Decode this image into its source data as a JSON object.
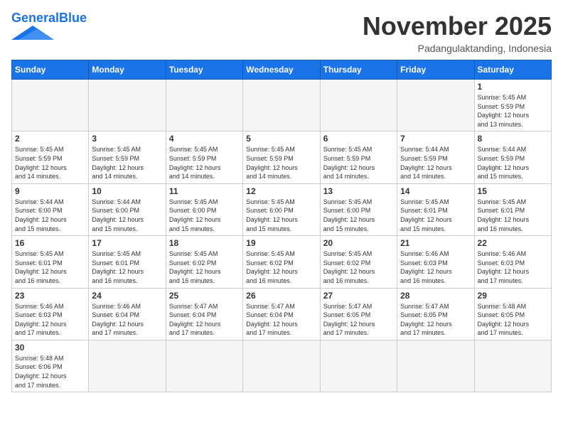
{
  "header": {
    "logo_general": "General",
    "logo_blue": "Blue",
    "month_title": "November 2025",
    "location": "Padangulaktanding, Indonesia"
  },
  "weekdays": [
    "Sunday",
    "Monday",
    "Tuesday",
    "Wednesday",
    "Thursday",
    "Friday",
    "Saturday"
  ],
  "weeks": [
    [
      {
        "day": "",
        "info": ""
      },
      {
        "day": "",
        "info": ""
      },
      {
        "day": "",
        "info": ""
      },
      {
        "day": "",
        "info": ""
      },
      {
        "day": "",
        "info": ""
      },
      {
        "day": "",
        "info": ""
      },
      {
        "day": "1",
        "info": "Sunrise: 5:45 AM\nSunset: 5:59 PM\nDaylight: 12 hours\nand 13 minutes."
      }
    ],
    [
      {
        "day": "2",
        "info": "Sunrise: 5:45 AM\nSunset: 5:59 PM\nDaylight: 12 hours\nand 14 minutes."
      },
      {
        "day": "3",
        "info": "Sunrise: 5:45 AM\nSunset: 5:59 PM\nDaylight: 12 hours\nand 14 minutes."
      },
      {
        "day": "4",
        "info": "Sunrise: 5:45 AM\nSunset: 5:59 PM\nDaylight: 12 hours\nand 14 minutes."
      },
      {
        "day": "5",
        "info": "Sunrise: 5:45 AM\nSunset: 5:59 PM\nDaylight: 12 hours\nand 14 minutes."
      },
      {
        "day": "6",
        "info": "Sunrise: 5:45 AM\nSunset: 5:59 PM\nDaylight: 12 hours\nand 14 minutes."
      },
      {
        "day": "7",
        "info": "Sunrise: 5:44 AM\nSunset: 5:59 PM\nDaylight: 12 hours\nand 14 minutes."
      },
      {
        "day": "8",
        "info": "Sunrise: 5:44 AM\nSunset: 5:59 PM\nDaylight: 12 hours\nand 15 minutes."
      }
    ],
    [
      {
        "day": "9",
        "info": "Sunrise: 5:44 AM\nSunset: 6:00 PM\nDaylight: 12 hours\nand 15 minutes."
      },
      {
        "day": "10",
        "info": "Sunrise: 5:44 AM\nSunset: 6:00 PM\nDaylight: 12 hours\nand 15 minutes."
      },
      {
        "day": "11",
        "info": "Sunrise: 5:45 AM\nSunset: 6:00 PM\nDaylight: 12 hours\nand 15 minutes."
      },
      {
        "day": "12",
        "info": "Sunrise: 5:45 AM\nSunset: 6:00 PM\nDaylight: 12 hours\nand 15 minutes."
      },
      {
        "day": "13",
        "info": "Sunrise: 5:45 AM\nSunset: 6:00 PM\nDaylight: 12 hours\nand 15 minutes."
      },
      {
        "day": "14",
        "info": "Sunrise: 5:45 AM\nSunset: 6:01 PM\nDaylight: 12 hours\nand 15 minutes."
      },
      {
        "day": "15",
        "info": "Sunrise: 5:45 AM\nSunset: 6:01 PM\nDaylight: 12 hours\nand 16 minutes."
      }
    ],
    [
      {
        "day": "16",
        "info": "Sunrise: 5:45 AM\nSunset: 6:01 PM\nDaylight: 12 hours\nand 16 minutes."
      },
      {
        "day": "17",
        "info": "Sunrise: 5:45 AM\nSunset: 6:01 PM\nDaylight: 12 hours\nand 16 minutes."
      },
      {
        "day": "18",
        "info": "Sunrise: 5:45 AM\nSunset: 6:02 PM\nDaylight: 12 hours\nand 16 minutes."
      },
      {
        "day": "19",
        "info": "Sunrise: 5:45 AM\nSunset: 6:02 PM\nDaylight: 12 hours\nand 16 minutes."
      },
      {
        "day": "20",
        "info": "Sunrise: 5:45 AM\nSunset: 6:02 PM\nDaylight: 12 hours\nand 16 minutes."
      },
      {
        "day": "21",
        "info": "Sunrise: 5:46 AM\nSunset: 6:03 PM\nDaylight: 12 hours\nand 16 minutes."
      },
      {
        "day": "22",
        "info": "Sunrise: 5:46 AM\nSunset: 6:03 PM\nDaylight: 12 hours\nand 17 minutes."
      }
    ],
    [
      {
        "day": "23",
        "info": "Sunrise: 5:46 AM\nSunset: 6:03 PM\nDaylight: 12 hours\nand 17 minutes."
      },
      {
        "day": "24",
        "info": "Sunrise: 5:46 AM\nSunset: 6:04 PM\nDaylight: 12 hours\nand 17 minutes."
      },
      {
        "day": "25",
        "info": "Sunrise: 5:47 AM\nSunset: 6:04 PM\nDaylight: 12 hours\nand 17 minutes."
      },
      {
        "day": "26",
        "info": "Sunrise: 5:47 AM\nSunset: 6:04 PM\nDaylight: 12 hours\nand 17 minutes."
      },
      {
        "day": "27",
        "info": "Sunrise: 5:47 AM\nSunset: 6:05 PM\nDaylight: 12 hours\nand 17 minutes."
      },
      {
        "day": "28",
        "info": "Sunrise: 5:47 AM\nSunset: 6:05 PM\nDaylight: 12 hours\nand 17 minutes."
      },
      {
        "day": "29",
        "info": "Sunrise: 5:48 AM\nSunset: 6:05 PM\nDaylight: 12 hours\nand 17 minutes."
      }
    ],
    [
      {
        "day": "30",
        "info": "Sunrise: 5:48 AM\nSunset: 6:06 PM\nDaylight: 12 hours\nand 17 minutes."
      },
      {
        "day": "",
        "info": ""
      },
      {
        "day": "",
        "info": ""
      },
      {
        "day": "",
        "info": ""
      },
      {
        "day": "",
        "info": ""
      },
      {
        "day": "",
        "info": ""
      },
      {
        "day": "",
        "info": ""
      }
    ]
  ]
}
